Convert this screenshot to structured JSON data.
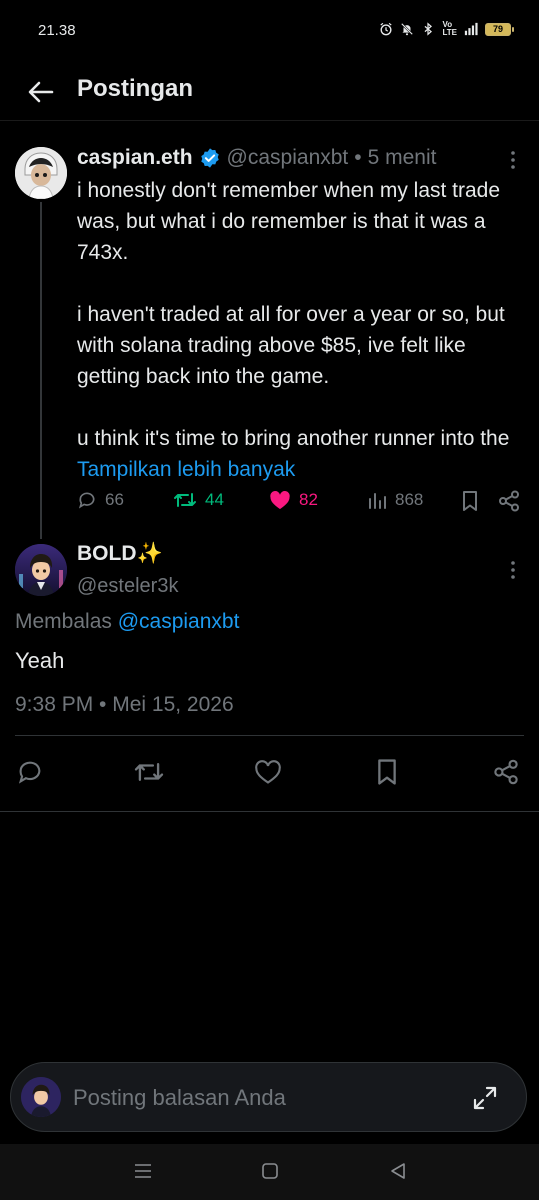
{
  "status_bar": {
    "time": "21.38",
    "network": "4G",
    "battery": "79"
  },
  "header": {
    "title": "Postingan"
  },
  "parent_post": {
    "name": "caspian.eth",
    "handle": "@caspianxbt",
    "separator": "•",
    "time": "5 menit",
    "paragraph1": "i honestly don't remember when my last trade was, but what i do remember is that it was a 743x.",
    "paragraph2": "i haven't traded at all for over a year or so, but with solana trading above $85, ive felt like getting back into the game.",
    "paragraph3": "u think it's time to bring another runner into the ",
    "show_more": "Tampilkan lebih banyak",
    "stats": {
      "replies": "66",
      "reposts": "44",
      "likes": "82",
      "views": "868"
    }
  },
  "reply_post": {
    "name": "BOLD✨",
    "handle": "@esteler3k",
    "replying_label": "Membalas ",
    "replying_to": "@caspianxbt",
    "text": "Yeah",
    "datetime": "9:38 PM • Mei 15, 2026"
  },
  "compose": {
    "placeholder": "Posting balasan Anda"
  },
  "colors": {
    "background": "#000000",
    "text": "#e7e9ea",
    "muted": "#71767b",
    "link": "#1d9bf0",
    "repost_active": "#00ba7c",
    "like_active": "#f91880"
  }
}
